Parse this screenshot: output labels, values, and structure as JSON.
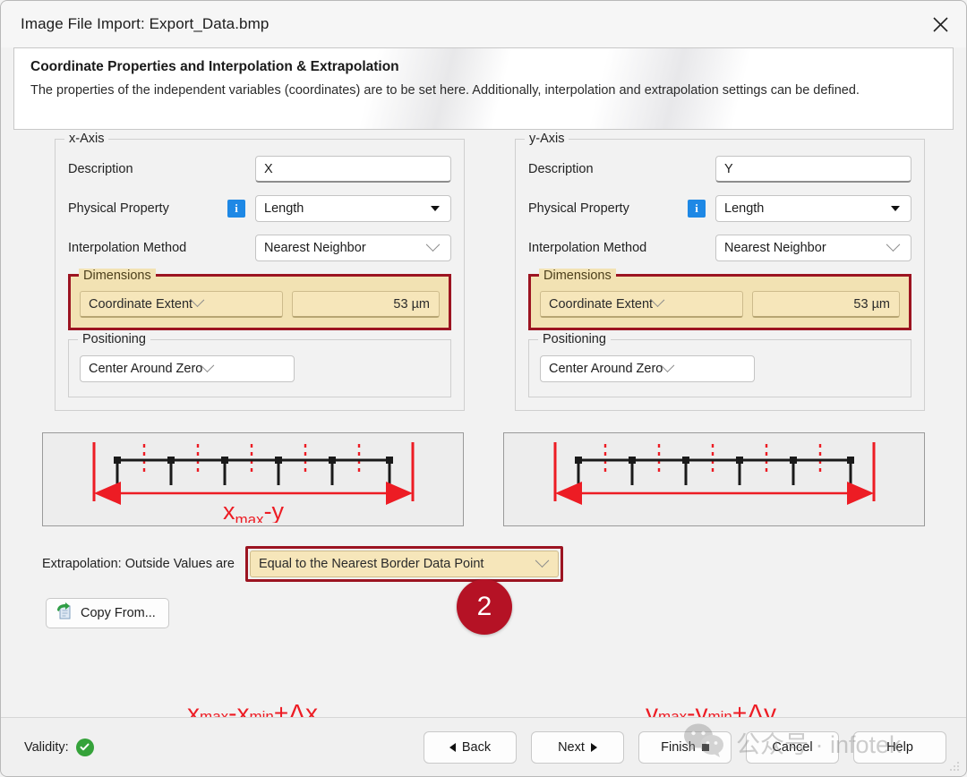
{
  "window": {
    "title": "Image File Import: Export_Data.bmp",
    "close_icon": "close-icon"
  },
  "banner": {
    "title": "Coordinate Properties and Interpolation & Extrapolation",
    "description": "The properties of the independent variables (coordinates) are to be set here. Additionally, interpolation and extrapolation settings can be defined."
  },
  "step_badge": "2",
  "x_axis": {
    "legend": "x-Axis",
    "description_label": "Description",
    "description_value": "X",
    "physical_property_label": "Physical Property",
    "physical_property_value": "Length",
    "info_icon": "info-icon",
    "interpolation_label": "Interpolation Method",
    "interpolation_value": "Nearest Neighbor",
    "dimensions_legend": "Dimensions",
    "dimensions_mode": "Coordinate Extent",
    "dimensions_value": "53 µm",
    "positioning_legend": "Positioning",
    "positioning_value": "Center Around Zero",
    "diagram_formula": "xmax-xmin+Δx",
    "diagram_sub_max": "max",
    "diagram_sub_min": "min",
    "diagram_var": "x",
    "diagram_delta": "+Δx"
  },
  "y_axis": {
    "legend": "y-Axis",
    "description_label": "Description",
    "description_value": "Y",
    "physical_property_label": "Physical Property",
    "physical_property_value": "Length",
    "info_icon": "info-icon",
    "interpolation_label": "Interpolation Method",
    "interpolation_value": "Nearest Neighbor",
    "dimensions_legend": "Dimensions",
    "dimensions_mode": "Coordinate Extent",
    "dimensions_value": "53 µm",
    "positioning_legend": "Positioning",
    "positioning_value": "Center Around Zero",
    "diagram_formula": "ymax-ymin+Δy",
    "diagram_sub_max": "max",
    "diagram_sub_min": "min",
    "diagram_var": "y",
    "diagram_delta": "+Δy"
  },
  "extrapolation": {
    "label": "Extrapolation: Outside Values are",
    "value": "Equal to the Nearest Border Data Point"
  },
  "copy_from": {
    "label": "Copy From...",
    "icon": "copy-document-icon"
  },
  "footer": {
    "validity_label": "Validity:",
    "validity_icon": "check-circle-icon",
    "back": "Back",
    "next": "Next",
    "finish": "Finish",
    "cancel": "Cancel",
    "help": "Help"
  },
  "watermark": {
    "text": "公众号 · infotek",
    "icon": "wechat-icon"
  },
  "colors": {
    "highlight_border": "#9c1421",
    "highlight_fill": "#f2e2b3",
    "badge": "#b51225",
    "info_blue": "#1e88e5",
    "valid_green": "#35a23a",
    "diagram_red": "#ed1c24"
  }
}
